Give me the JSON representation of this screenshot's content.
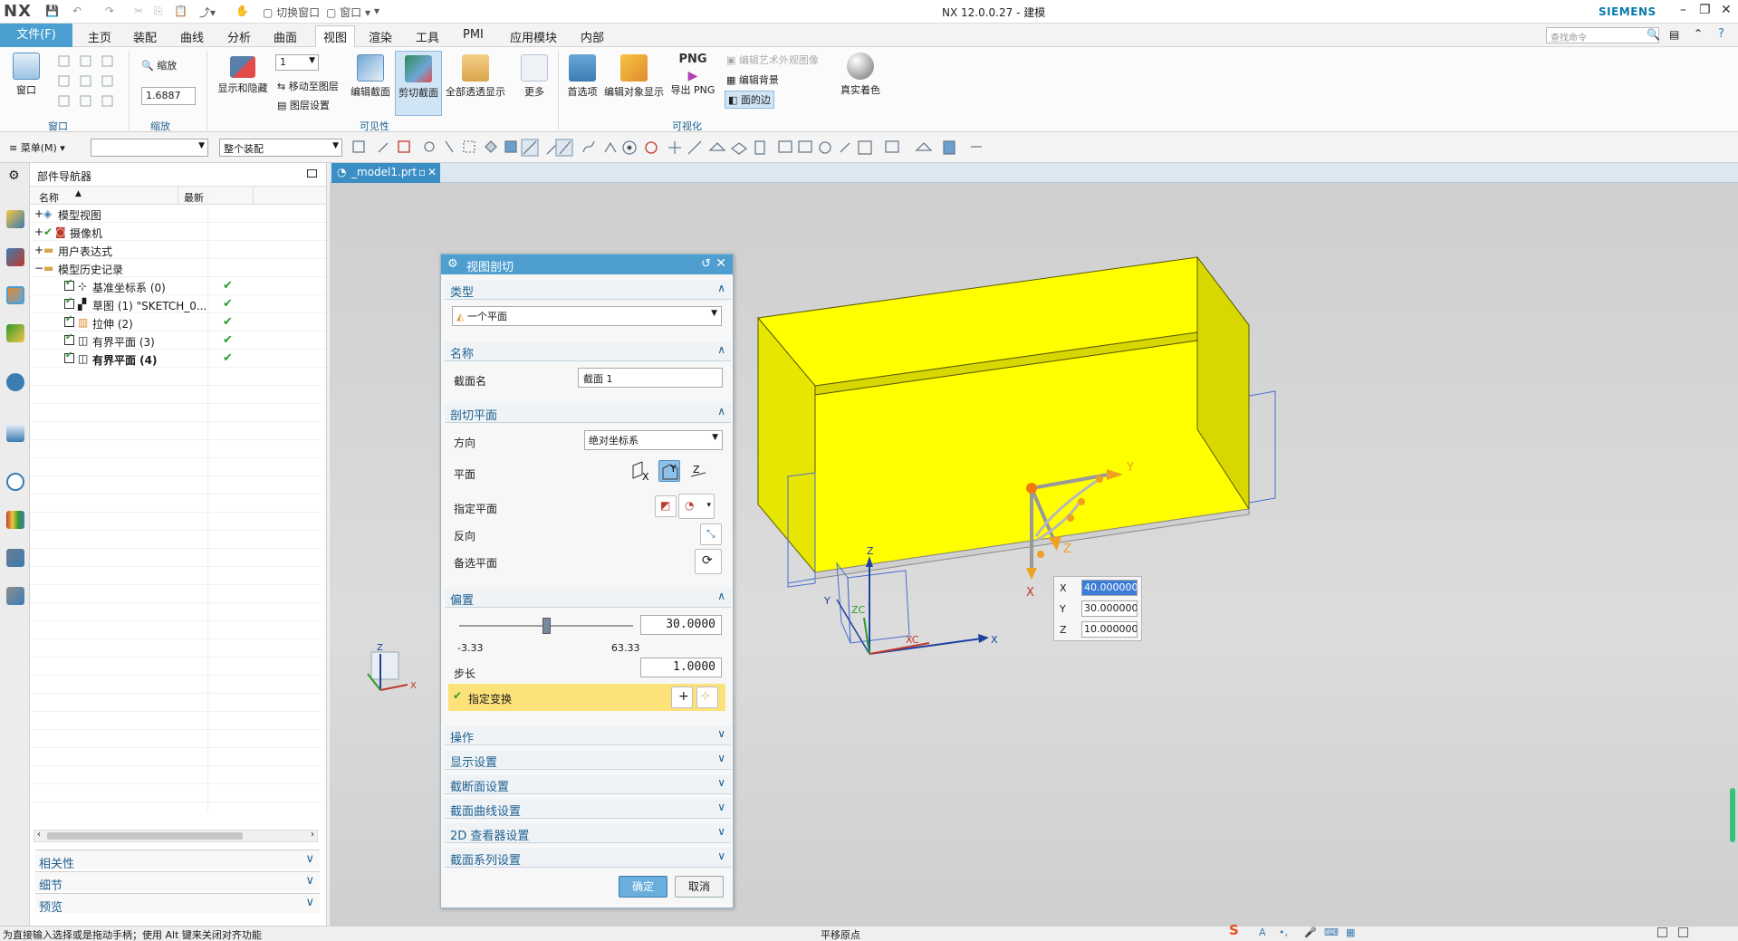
{
  "titlebar": {
    "logo": "NX",
    "switch_window": "切换窗口",
    "window_menu": "窗口",
    "title": "NX 12.0.0.27 - 建模",
    "brand": "SIEMENS"
  },
  "menubar": {
    "file": "文件(F)",
    "items": [
      "主页",
      "装配",
      "曲线",
      "分析",
      "曲面",
      "视图",
      "渲染",
      "工具",
      "PMI",
      "应用模块",
      "内部"
    ],
    "active": "视图",
    "search_placeholder": "查找命令"
  },
  "ribbon": {
    "window_label": "窗口",
    "zoom_label": "缩放",
    "zoom_value": "1.6887",
    "layer_dropdown": "1",
    "show_hide": "显示和隐藏",
    "move_to_layer": "移动至图层",
    "layer_settings": "图层设置",
    "edit_section": "编辑截面",
    "clip_section": "剪切截面",
    "full_transparency": "全部透透显示",
    "more": "更多",
    "preferences": "首选项",
    "edit_obj_display": "编辑对象显示",
    "export_png": "导出 PNG",
    "png_text": "PNG",
    "artistic_appearance": "编辑艺术外观图像",
    "edit_background": "编辑背景",
    "face_edges": "面的边",
    "true_shading": "真实着色",
    "groups": [
      "窗口",
      "缩放",
      "可见性",
      "可视化"
    ]
  },
  "toolbar": {
    "menu_label": "菜单(M)",
    "filter_combo": "",
    "scope_combo": "整个装配"
  },
  "navigator": {
    "title": "部件导航器",
    "col_name": "名称",
    "col_latest": "最新",
    "rows": [
      {
        "label": "模型视图",
        "checked": false,
        "ok": false
      },
      {
        "label": "摄像机",
        "checked": false,
        "ok": false
      },
      {
        "label": "用户表达式",
        "checked": false,
        "ok": false
      },
      {
        "label": "模型历史记录",
        "checked": false,
        "ok": false
      },
      {
        "label": "基准坐标系 (0)",
        "checked": true,
        "ok": true
      },
      {
        "label": "草图 (1) \"SKETCH_0...",
        "checked": true,
        "ok": true
      },
      {
        "label": "拉伸 (2)",
        "checked": true,
        "ok": true
      },
      {
        "label": "有界平面 (3)",
        "checked": true,
        "ok": true
      },
      {
        "label": "有界平面 (4)",
        "checked": true,
        "ok": true
      }
    ],
    "accordions": [
      "相关性",
      "细节",
      "预览"
    ]
  },
  "tab": {
    "label": "_model1.prt"
  },
  "dialog": {
    "title": "视图剖切",
    "type_section": "类型",
    "type_value": "一个平面",
    "name_section": "名称",
    "section_name_label": "截面名",
    "section_name_value": "截面 1",
    "clip_plane_section": "剖切平面",
    "direction_label": "方向",
    "direction_value": "绝对坐标系",
    "plane_label": "平面",
    "specify_plane_label": "指定平面",
    "reverse_label": "反向",
    "alternate_plane_label": "备选平面",
    "offset_section": "偏置",
    "offset_value": "30.0000",
    "slider_min": "-3.33",
    "slider_max": "63.33",
    "slider_fraction": 0.5,
    "step_label": "步长",
    "step_value": "1.0000",
    "specify_transform": "指定变换",
    "collapsed_sections": [
      "操作",
      "显示设置",
      "截断面设置",
      "截面曲线设置",
      "2D 查看器设置",
      "截面系列设置"
    ],
    "ok_label": "确定",
    "cancel_label": "取消"
  },
  "coords": {
    "x_label": "X",
    "x_value": "40.000000",
    "y_label": "Y",
    "y_value": "30.000000",
    "z_label": "Z",
    "z_value": "10.000000"
  },
  "viewport_labels": {
    "y_axis": "Y",
    "z_axis": "Z",
    "x_axis": "X",
    "zc": "ZC",
    "xc": "XC"
  },
  "status": {
    "message": "为直接输入选择或是拖动手柄；使用 Alt 键来关闭对齐功能",
    "mode": "平移原点"
  },
  "colors": {
    "accent": "#4e9ed0",
    "model_yellow": "#ffff00",
    "handle_orange": "#f0a020",
    "ok_green": "#2e9b2e",
    "transform_bg": "#fde27a"
  }
}
